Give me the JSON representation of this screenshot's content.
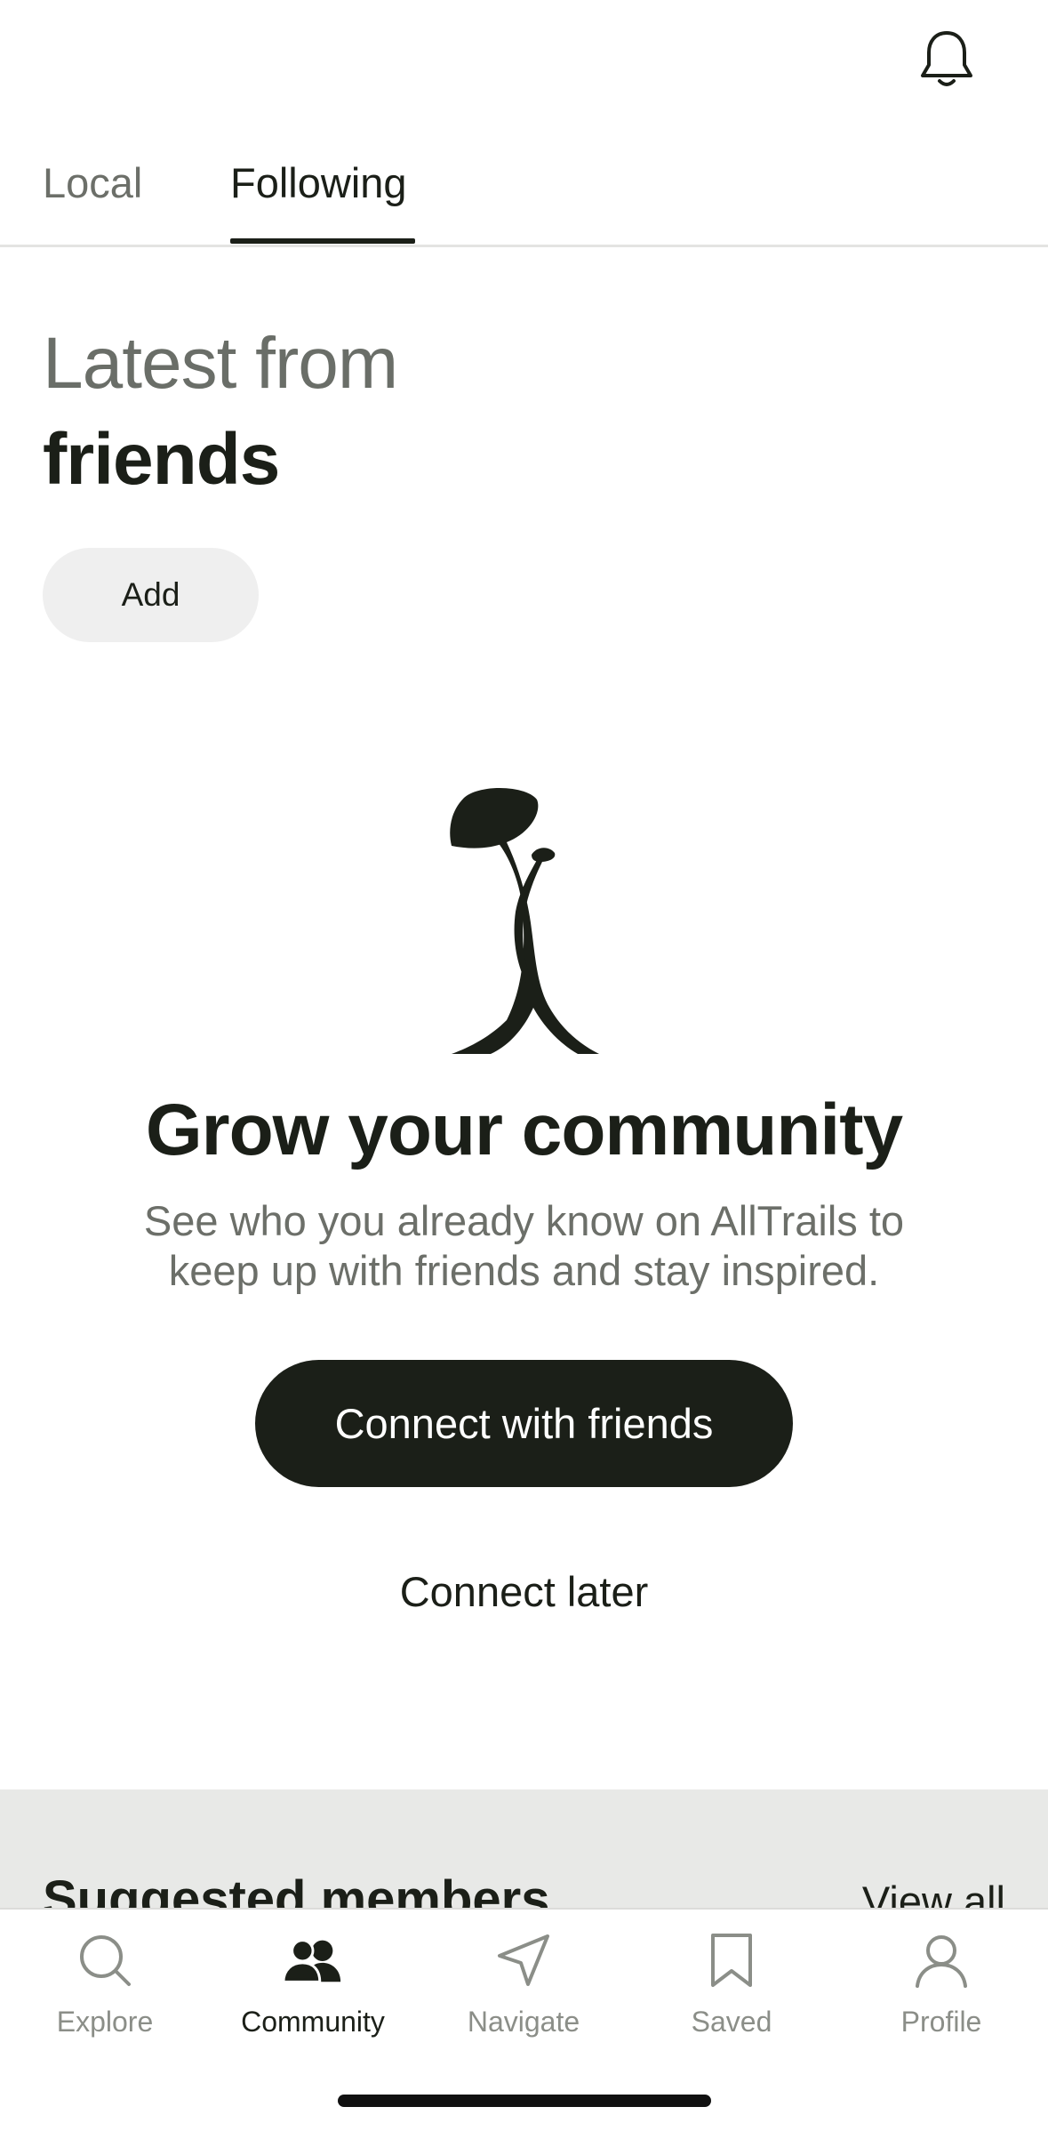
{
  "header": {
    "notification_icon": "bell-icon"
  },
  "tabs": [
    {
      "label": "Local",
      "active": false
    },
    {
      "label": "Following",
      "active": true
    }
  ],
  "section": {
    "title_line1": "Latest from",
    "title_line2": "friends",
    "add_label": "Add"
  },
  "empty_state": {
    "illustration_icon": "mushroom-figure-illustration",
    "title": "Grow your community",
    "description": "See who you already know on AllTrails to keep up with friends and stay inspired.",
    "primary_button": "Connect with friends",
    "secondary_button": "Connect later"
  },
  "suggested": {
    "title": "Suggested members",
    "view_all": "View all"
  },
  "bottom_nav": [
    {
      "label": "Explore",
      "icon": "search-icon",
      "active": false
    },
    {
      "label": "Community",
      "icon": "community-icon",
      "active": true
    },
    {
      "label": "Navigate",
      "icon": "navigate-icon",
      "active": false
    },
    {
      "label": "Saved",
      "icon": "bookmark-icon",
      "active": false
    },
    {
      "label": "Profile",
      "icon": "profile-icon",
      "active": false
    }
  ],
  "colors": {
    "primary": "#1b1f18",
    "muted_text": "#6c6f69",
    "add_button_bg": "#efefef",
    "suggested_bg": "#e8e9e7"
  }
}
